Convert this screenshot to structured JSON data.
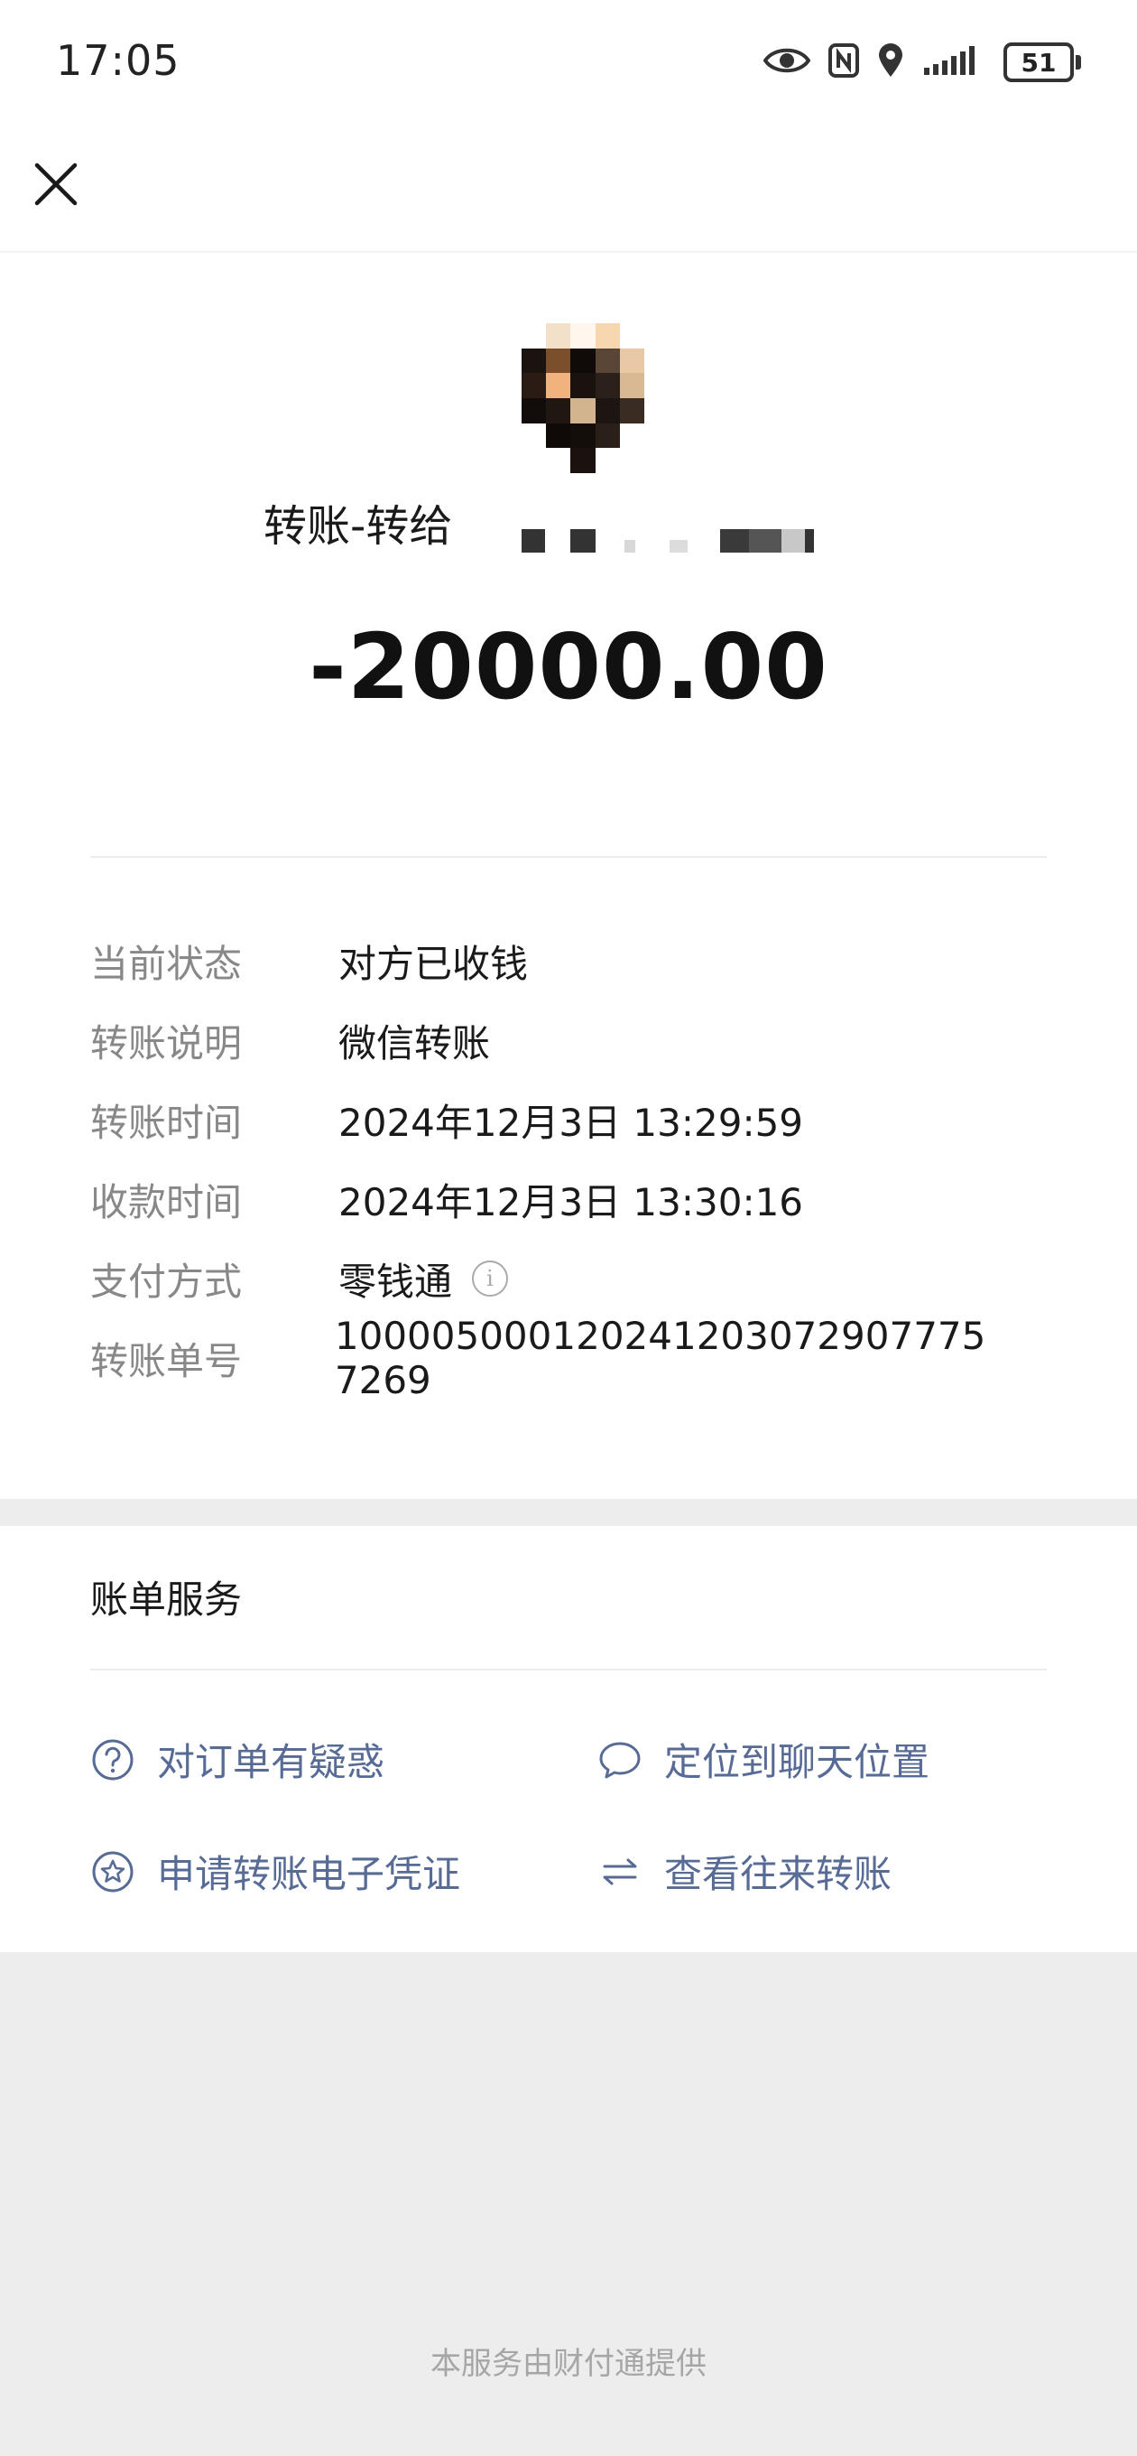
{
  "status_bar": {
    "time": "17:05",
    "battery": "51",
    "icons": [
      "eye-icon",
      "nfc-icon",
      "location-icon",
      "signal-icon",
      "battery-icon"
    ]
  },
  "header": {
    "close_icon": "close-icon"
  },
  "transfer": {
    "title": "转账-转给",
    "amount": "-20000.00"
  },
  "details": [
    {
      "label": "当前状态",
      "value": "对方已收钱"
    },
    {
      "label": "转账说明",
      "value": "微信转账"
    },
    {
      "label": "转账时间",
      "value": "2024年12月3日 13:29:59"
    },
    {
      "label": "收款时间",
      "value": "2024年12月3日 13:30:16"
    },
    {
      "label": "支付方式",
      "value": "零钱通"
    },
    {
      "label": "转账单号",
      "value": "100005000120241203072907775 7269"
    }
  ],
  "services": {
    "title": "账单服务",
    "items": [
      {
        "label": "对订单有疑惑",
        "icon": "question-circle-icon"
      },
      {
        "label": "定位到聊天位置",
        "icon": "chat-bubble-icon"
      },
      {
        "label": "申请转账电子凭证",
        "icon": "star-badge-icon"
      },
      {
        "label": "查看往来转账",
        "icon": "swap-arrows-icon"
      }
    ]
  },
  "footer": {
    "text": "本服务由财付通提供"
  },
  "colors": {
    "link": "#576b95",
    "label": "#888888",
    "background": "#ededed"
  }
}
